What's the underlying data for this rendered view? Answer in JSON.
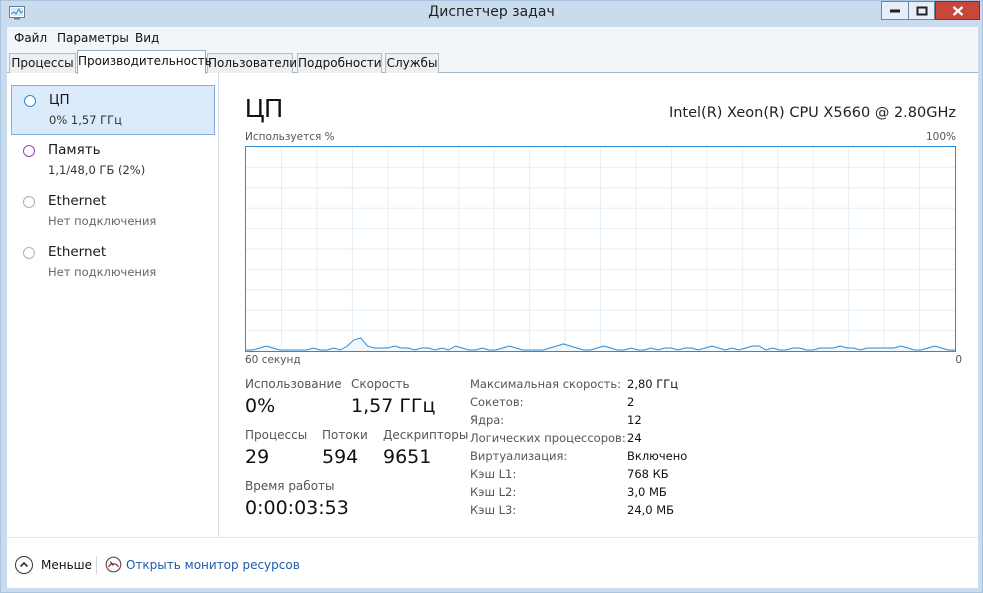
{
  "window": {
    "title": "Диспетчер задач",
    "accent_color": "#2a8cd6"
  },
  "menu": [
    "Файл",
    "Параметры",
    "Вид"
  ],
  "tabs": [
    {
      "label": "Процессы",
      "active": false
    },
    {
      "label": "Производительность",
      "active": true
    },
    {
      "label": "Пользователи",
      "active": false
    },
    {
      "label": "Подробности",
      "active": false
    },
    {
      "label": "Службы",
      "active": false
    }
  ],
  "sidebar": {
    "items": [
      {
        "title": "ЦП",
        "subtitle": "0%  1,57 ГГц",
        "circle_color": "#2a8cd6",
        "selected": true
      },
      {
        "title": "Память",
        "subtitle": "1,1/48,0 ГБ (2%)",
        "circle_color": "#a040b8",
        "selected": false
      },
      {
        "title": "Ethernet",
        "subtitle": "Нет подключения",
        "circle_color": "#b0b0b0",
        "selected": false
      },
      {
        "title": "Ethernet",
        "subtitle": "Нет подключения",
        "circle_color": "#b0b0b0",
        "selected": false
      }
    ]
  },
  "main": {
    "title": "ЦП",
    "cpu_name": "Intel(R) Xeon(R) CPU X5660 @ 2.80GHz",
    "graph": {
      "y_label": "Используется %",
      "y_max_label": "100%",
      "x_left_label": "60 секунд",
      "x_right_label": "0",
      "usage_percent": [
        0,
        0,
        1,
        2,
        1,
        0,
        0,
        0,
        0,
        0,
        1,
        0,
        0,
        1,
        0,
        2,
        5,
        6,
        2,
        1,
        1,
        1,
        2,
        1,
        1,
        0,
        1,
        1,
        0,
        1,
        0,
        2,
        1,
        0,
        0,
        1,
        0,
        0,
        1,
        2,
        1,
        0,
        0,
        0,
        0,
        1,
        2,
        3,
        2,
        1,
        0,
        0,
        1,
        2,
        1,
        0,
        0,
        1,
        0,
        0,
        1,
        0,
        1,
        1,
        0,
        1,
        1,
        0,
        1,
        2,
        1,
        0,
        1,
        0,
        1,
        2,
        2,
        0,
        1,
        0,
        0,
        1,
        1,
        0,
        0,
        1,
        1,
        1,
        2,
        1,
        1,
        0,
        1,
        1,
        1,
        1,
        1,
        2,
        1,
        0,
        0,
        1,
        2,
        1,
        0,
        0
      ]
    },
    "stats": {
      "usage_label": "Использование",
      "usage_value": "0%",
      "speed_label": "Скорость",
      "speed_value": "1,57 ГГц",
      "processes_label": "Процессы",
      "processes_value": "29",
      "threads_label": "Потоки",
      "threads_value": "594",
      "handles_label": "Дескрипторы",
      "handles_value": "9651",
      "uptime_label": "Время работы",
      "uptime_value": "0:00:03:53"
    },
    "specs": [
      {
        "label": "Максимальная скорость:",
        "value": "2,80 ГГц"
      },
      {
        "label": "Сокетов:",
        "value": "2"
      },
      {
        "label": "Ядра:",
        "value": "12"
      },
      {
        "label": "Логических процессоров:",
        "value": "24"
      },
      {
        "label": "Виртуализация:",
        "value": "Включено"
      },
      {
        "label": "Кэш L1:",
        "value": "768 КБ"
      },
      {
        "label": "Кэш L2:",
        "value": "3,0 МБ"
      },
      {
        "label": "Кэш L3:",
        "value": "24,0 МБ"
      }
    ]
  },
  "footer": {
    "less_label": "Меньше",
    "monitor_link": "Открыть монитор ресурсов"
  }
}
